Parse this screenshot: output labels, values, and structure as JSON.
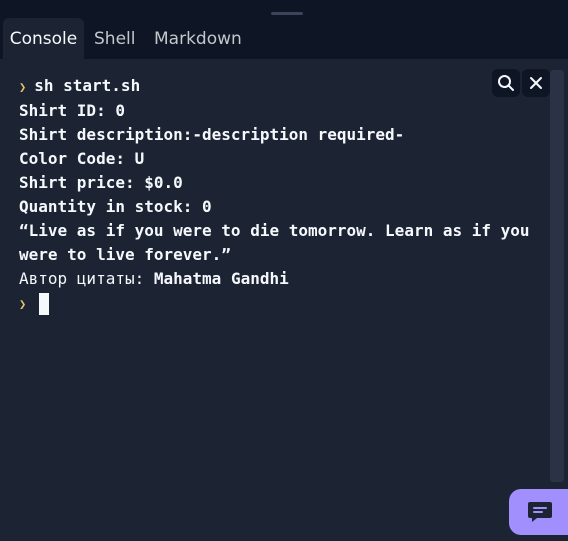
{
  "tabs": [
    {
      "label": "Console",
      "active": true
    },
    {
      "label": "Shell",
      "active": false
    },
    {
      "label": "Markdown",
      "active": false
    }
  ],
  "console": {
    "command": "sh start.sh",
    "output": [
      "Shirt ID: 0",
      "Shirt description:-description required-",
      "Color Code: U",
      "Shirt price: $0.0",
      "Quantity in stock: 0"
    ],
    "quote": "“Live as if you were to die tomorrow. Learn as if you were to live forever.”",
    "author_label": "Автор цитаты:",
    "author_name": "Mahatma Gandhi"
  },
  "icons": {
    "prompt": "chevron-right-icon",
    "search": "search-icon",
    "close": "close-icon",
    "chat": "chat-bubble-icon"
  },
  "colors": {
    "background": "#0e1525",
    "console_bg": "#1c2333",
    "text": "#f5f9fc",
    "prompt": "#e6c36c",
    "chat_button": "#a18ffe"
  }
}
